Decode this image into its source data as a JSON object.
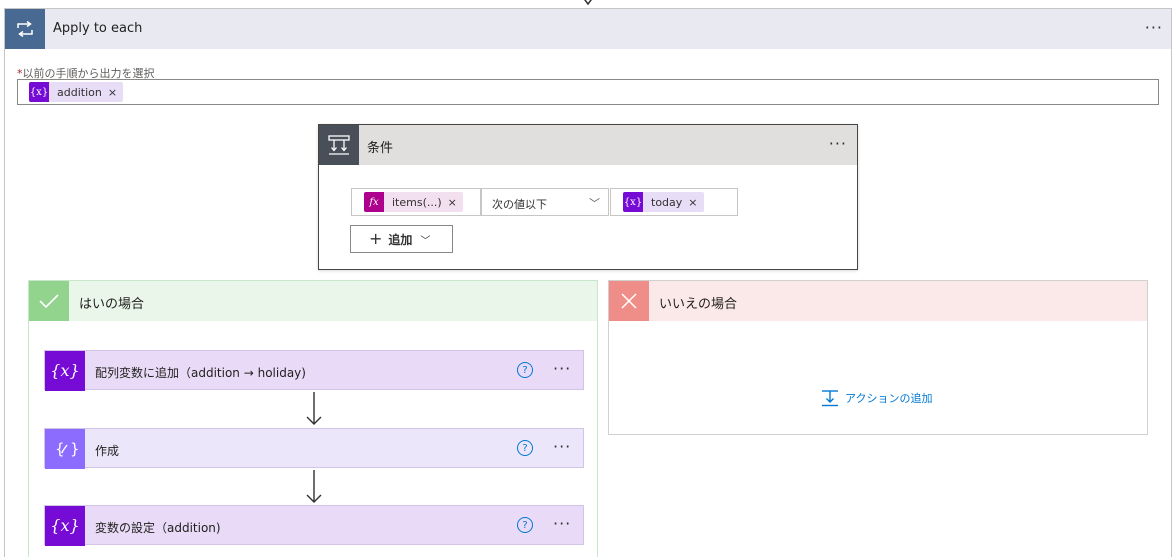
{
  "apply_to_each": {
    "title": "Apply to each",
    "field_label": "以前の手順から出力を選択",
    "required_mark": "*",
    "token_label": "addition",
    "more": "···"
  },
  "condition": {
    "title": "条件",
    "more": "···",
    "left_token": "items(...)",
    "operator": "次の値以下",
    "right_token": "today",
    "add_button": "追加"
  },
  "yes_branch": {
    "title": "はいの場合",
    "actions": [
      {
        "title": "配列変数に追加（addition → holiday)",
        "help": "?",
        "more": "···"
      },
      {
        "title": "作成",
        "help": "?",
        "more": "···"
      },
      {
        "title": "変数の設定（addition)",
        "help": "?",
        "more": "···"
      }
    ]
  },
  "no_branch": {
    "title": "いいえの場合",
    "add_action": "アクションの追加"
  },
  "icons": {
    "token_var": "{x}",
    "token_fx": "fx",
    "remove": "×",
    "chevron": "﹀"
  },
  "colors": {
    "loop_header": "#486991",
    "condition_header": "#484f58",
    "yes_accent": "#92d38e",
    "no_accent": "#ef8d89",
    "variable_purple": "#770bd6",
    "compose_purple": "#8c6cff",
    "link_blue": "#0078d4"
  }
}
